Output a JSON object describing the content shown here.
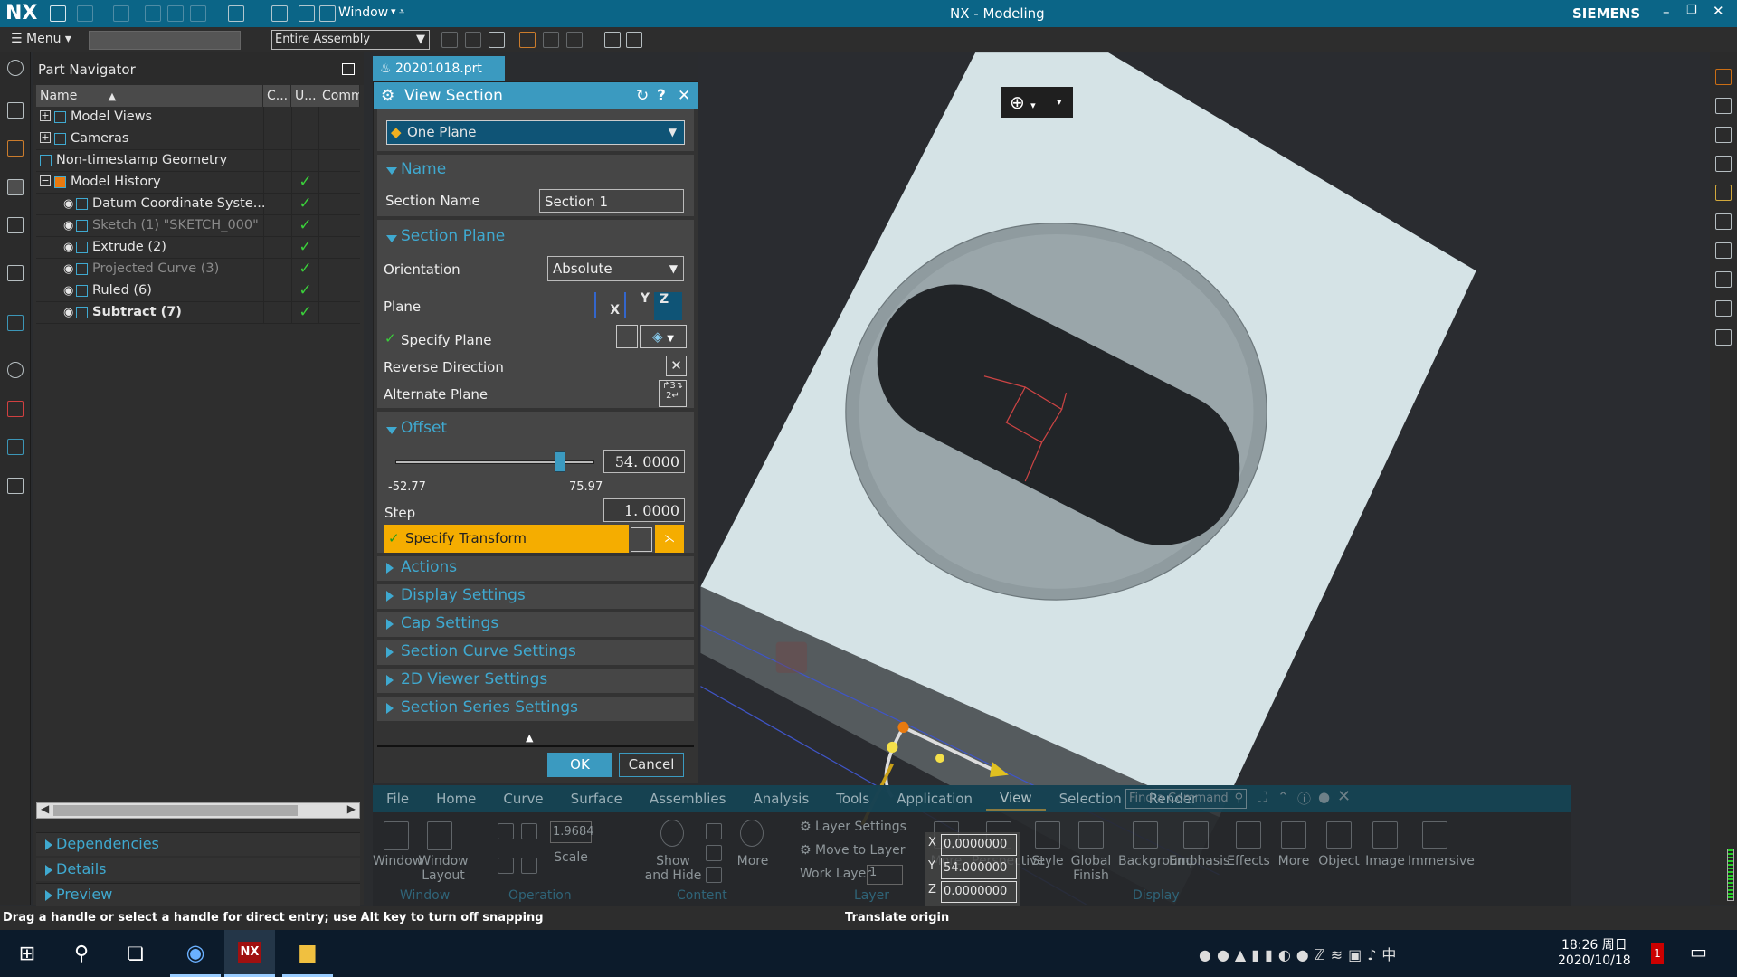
{
  "app": {
    "logo": "NX",
    "title": "NX - Modeling",
    "brand": "SIEMENS",
    "window_menu": "Window",
    "accent": "#0b6587"
  },
  "toolbar": {
    "menu_label": "Menu",
    "filter_value": "",
    "scope_value": "Entire Assembly"
  },
  "part_navigator": {
    "title": "Part Navigator",
    "columns": [
      "Name",
      "C...",
      "U...",
      "Comm"
    ],
    "rows": [
      {
        "label": "Model Views",
        "level": 0,
        "expander": "+",
        "style": "normal",
        "check": ""
      },
      {
        "label": "Cameras",
        "level": 0,
        "expander": "+",
        "style": "normal",
        "check": ""
      },
      {
        "label": "Non-timestamp Geometry",
        "level": 0,
        "expander": "",
        "style": "normal",
        "check": ""
      },
      {
        "label": "Model History",
        "level": 0,
        "expander": "-",
        "style": "normal",
        "check": "✓"
      },
      {
        "label": "Datum Coordinate Syste...",
        "level": 1,
        "style": "normal",
        "check": "✓"
      },
      {
        "label": "Sketch (1) \"SKETCH_000\"",
        "level": 1,
        "style": "gray",
        "check": "✓"
      },
      {
        "label": "Extrude (2)",
        "level": 1,
        "style": "normal",
        "check": "✓"
      },
      {
        "label": "Projected Curve (3)",
        "level": 1,
        "style": "gray",
        "check": "✓"
      },
      {
        "label": "Ruled (6)",
        "level": 1,
        "style": "normal",
        "check": "✓"
      },
      {
        "label": "Subtract (7)",
        "level": 1,
        "style": "bold",
        "check": "✓"
      }
    ],
    "sections": [
      "Dependencies",
      "Details",
      "Preview"
    ]
  },
  "file_tab": {
    "label": "20201018.prt"
  },
  "dialog": {
    "title": "View Section",
    "type_value": "One Plane",
    "name_group": {
      "header": "Name",
      "section_name_label": "Section Name",
      "section_name_value": "Section 1"
    },
    "plane_group": {
      "header": "Section Plane",
      "orientation_label": "Orientation",
      "orientation_value": "Absolute",
      "plane_label": "Plane",
      "plane_options": [
        "X",
        "Y",
        "Z"
      ],
      "plane_selected": "Z",
      "specify_plane": "Specify Plane",
      "reverse_direction": "Reverse Direction",
      "alternate_plane": "Alternate Plane"
    },
    "offset_group": {
      "header": "Offset",
      "value": "54. 0000",
      "slider_min": "-52.77",
      "slider_max": "75.97",
      "slider_value": 54.0,
      "step_label": "Step",
      "step_value": "1. 0000",
      "specify_transform": "Specify Transform"
    },
    "collapsed_groups": [
      "Actions",
      "Display Settings",
      "Cap Settings",
      "Section Curve Settings",
      "2D Viewer Settings",
      "Section Series Settings"
    ],
    "ok": "OK",
    "cancel": "Cancel"
  },
  "ribbon": {
    "tabs": [
      "File",
      "Home",
      "Curve",
      "Surface",
      "Assemblies",
      "Analysis",
      "Tools",
      "Application",
      "View",
      "Selection",
      "Render"
    ],
    "active_tab": "View",
    "search_placeholder": "Find a Command",
    "window": {
      "group": "Window",
      "window": "Window",
      "window_layout": "Window Layout"
    },
    "operation": {
      "group": "Operation",
      "scale_value": "1.9684",
      "scale_label": "Scale"
    },
    "content": {
      "group": "Content",
      "show_hide": "Show and Hide",
      "more": "More"
    },
    "layer": {
      "group": "Layer",
      "layer_settings": "Layer Settings",
      "move_to_layer": "Move to Layer",
      "work_layer_label": "Work Layer",
      "work_layer_value": "1"
    },
    "display": {
      "group": "Display",
      "items": [
        "More",
        "Perspective",
        "Style",
        "Global Finish",
        "Background",
        "Emphasis",
        "Effects",
        "More"
      ]
    },
    "extra": [
      "Object",
      "Image",
      "Immersive"
    ]
  },
  "coord_entry": {
    "x": "0.0000000",
    "y": "54.000000",
    "z": "0.0000000"
  },
  "status": {
    "left": "Drag a handle or select a handle for direct entry; use Alt key to turn off snapping",
    "center": "Translate origin"
  },
  "taskbar": {
    "time": "18:26 周日",
    "date": "2020/10/18",
    "notification_count": "1"
  }
}
